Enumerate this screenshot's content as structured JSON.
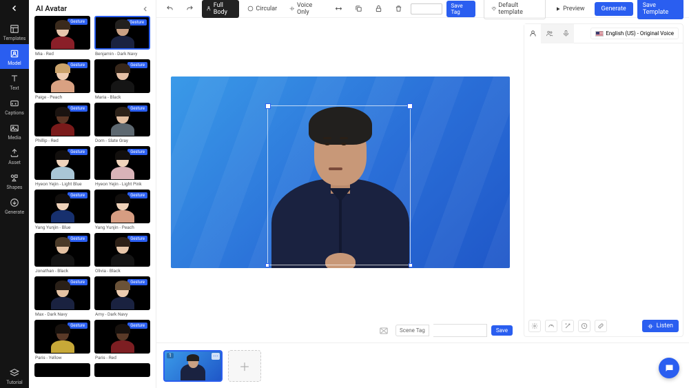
{
  "rail": {
    "items": [
      {
        "label": "Templates",
        "icon": "templates"
      },
      {
        "label": "Model",
        "icon": "model",
        "active": true
      },
      {
        "label": "Text",
        "icon": "text"
      },
      {
        "label": "Captions",
        "icon": "captions"
      },
      {
        "label": "Media",
        "icon": "media"
      },
      {
        "label": "Asset",
        "icon": "asset"
      },
      {
        "label": "Shapes",
        "icon": "shapes"
      },
      {
        "label": "Generate",
        "icon": "generate"
      }
    ],
    "tutorial": "Tutorial"
  },
  "panel": {
    "title": "AI Avatar",
    "badge": "Gesture",
    "avatars": [
      {
        "name": "Mia - Red",
        "skin": "#e8c6ad",
        "hair": "#3a2a1c",
        "shirt": "#8a1f28"
      },
      {
        "name": "Benjamin - Dark Navy",
        "skin": "#caa184",
        "hair": "#22201e",
        "shirt": "#1a2240",
        "selected": true
      },
      {
        "name": "Paige - Peach",
        "skin": "#efcdb2",
        "hair": "#caa26a",
        "shirt": "#d9a182"
      },
      {
        "name": "Maria - Black",
        "skin": "#e6c1a6",
        "hair": "#37271a",
        "shirt": "#151515"
      },
      {
        "name": "Phillip - Red",
        "skin": "#5b3524",
        "hair": "#1a1310",
        "shirt": "#7a1a1a"
      },
      {
        "name": "Dom - Slate Gray",
        "skin": "#e3bfa1",
        "hair": "#2c2219",
        "shirt": "#5d6870"
      },
      {
        "name": "Hyeon Yejin - Light Blue",
        "skin": "#f0d4bc",
        "hair": "#120f0d",
        "shirt": "#a9c6d6"
      },
      {
        "name": "Hyeon Yejin - Light Pink",
        "skin": "#f0d4bc",
        "hair": "#120f0d",
        "shirt": "#d9b3b8"
      },
      {
        "name": "Yang Yunjin - Blue",
        "skin": "#efd2b9",
        "hair": "#110e0c",
        "shirt": "#17306e"
      },
      {
        "name": "Yang Yunjin - Peach",
        "skin": "#efd2b9",
        "hair": "#110e0c",
        "shirt": "#d69d82"
      },
      {
        "name": "Jonathan - Black",
        "skin": "#e4c2a3",
        "hair": "#4a3a28",
        "shirt": "#141414"
      },
      {
        "name": "Olivia - Black",
        "skin": "#e8c7aa",
        "hair": "#2d2016",
        "shirt": "#141414"
      },
      {
        "name": "Max - Dark Navy",
        "skin": "#e4c2a3",
        "hair": "#2a2018",
        "shirt": "#1a2240"
      },
      {
        "name": "Amy - Dark Navy",
        "skin": "#ecccb0",
        "hair": "#6a5238",
        "shirt": "#1a2240"
      },
      {
        "name": "Paris - Yellow",
        "skin": "#5a3a28",
        "hair": "#17110d",
        "shirt": "#c7a838"
      },
      {
        "name": "Paris - Red",
        "skin": "#5a3a28",
        "hair": "#17110d",
        "shirt": "#7d1e22"
      }
    ]
  },
  "toolbar": {
    "fullBody": "Full Body",
    "circular": "Circular",
    "voiceOnly": "Voice Only",
    "saveTag": "Save Tag",
    "defaultTemplate": "Default template",
    "preview": "Preview",
    "generate": "Generate",
    "saveTemplate": "Save Template"
  },
  "sceneBar": {
    "label": "Scene Tag",
    "save": "Save"
  },
  "rightPanel": {
    "language": "English (US) - Original Voice",
    "listen": "Listen"
  },
  "timeline": {
    "sceneNumber": "1"
  }
}
